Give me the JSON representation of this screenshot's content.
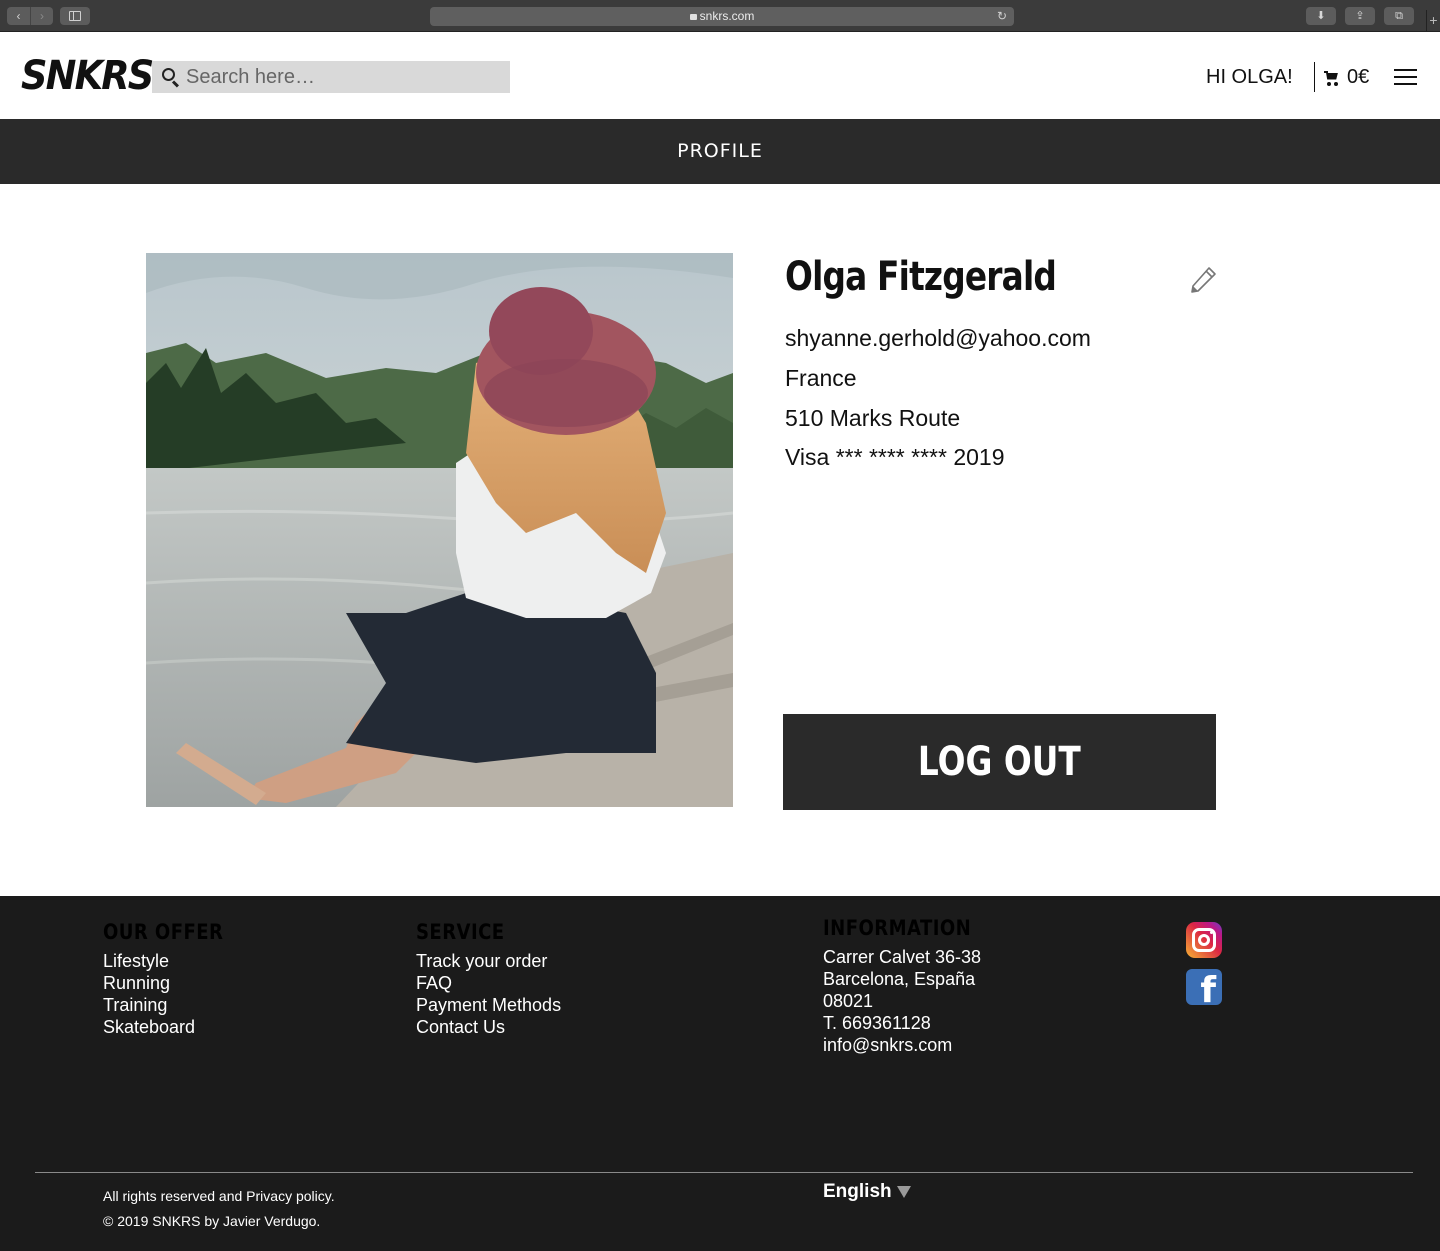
{
  "browser": {
    "url": "snkrs.com",
    "back_icon": "‹",
    "forward_icon": "›",
    "reload_icon": "↻",
    "download_icon": "⬇",
    "share_icon": "⇪",
    "tabs_icon": "⧉",
    "new_tab_icon": "+"
  },
  "header": {
    "logo": "SNKRS",
    "search_placeholder": "Search here…",
    "greeting": "HI OLGA!",
    "cart_total": "0€"
  },
  "page": {
    "title": "PROFILE"
  },
  "profile": {
    "name": "Olga Fitzgerald",
    "email": "shyanne.gerhold@yahoo.com",
    "country": "France",
    "address": "510 Marks Route",
    "card": "Visa *** **** **** 2019",
    "logout_label": "LOG OUT"
  },
  "footer": {
    "offer": {
      "heading": "OUR OFFER",
      "links": [
        "Lifestyle",
        "Running",
        "Training",
        "Skateboard"
      ]
    },
    "service": {
      "heading": "SERVICE",
      "links": [
        "Track your order",
        "FAQ",
        "Payment Methods",
        "Contact Us"
      ]
    },
    "information": {
      "heading": "INFORMATION",
      "lines": [
        "Carrer Calvet 36-38",
        "Barcelona, España",
        "08021",
        "T. 669361128",
        "info@snkrs.com"
      ]
    },
    "social": [
      "instagram-icon",
      "facebook-icon"
    ],
    "legal_1": "All rights reserved and Privacy policy.",
    "legal_2": "© 2019 SNKRS by Javier Verdugo.",
    "language": "English"
  },
  "colors": {
    "dark": "#2a2a2a",
    "footer_bg": "#1b1b1b",
    "search_bg": "#d9d9d9"
  }
}
